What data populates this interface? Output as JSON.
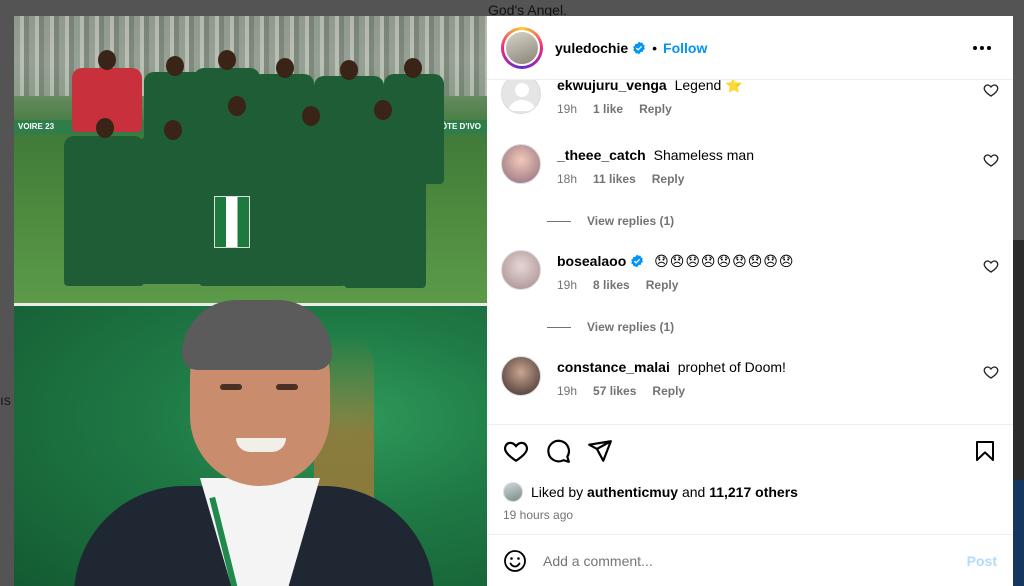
{
  "background": {
    "top_text": "God's Angel.",
    "left_text": "ıs"
  },
  "media": {
    "banner_left": "VOIRE 23",
    "banner_right": "CÔTE D'IVO"
  },
  "header": {
    "username": "yuledochie",
    "verified": true,
    "separator": "•",
    "follow_label": "Follow"
  },
  "comments": [
    {
      "username": "ekwujuru_venga",
      "text": "Legend",
      "emoji": "⭐",
      "time": "19h",
      "likes": "1 like",
      "reply": "Reply"
    },
    {
      "username": "_theee_catch",
      "text": "Shameless man",
      "time": "18h",
      "likes": "11 likes",
      "reply": "Reply",
      "view_replies": "View replies (1)"
    },
    {
      "username": "bosealaoo",
      "verified": true,
      "text": "😞😞😞😞😞😞😞😞😞",
      "time": "19h",
      "likes": "8 likes",
      "reply": "Reply",
      "view_replies": "View replies (1)"
    },
    {
      "username": "constance_malai",
      "text": "prophet of Doom!",
      "time": "19h",
      "likes": "57 likes",
      "reply": "Reply"
    }
  ],
  "likes": {
    "prefix": "Liked by",
    "user": "authenticmuy",
    "conjunction": "and",
    "others": "11,217 others"
  },
  "timestamp": "19 hours ago",
  "composer": {
    "placeholder": "Add a comment...",
    "post_label": "Post"
  },
  "colors": {
    "accent": "#0095f6",
    "muted": "#737373",
    "post_disabled": "#b3dbff"
  }
}
